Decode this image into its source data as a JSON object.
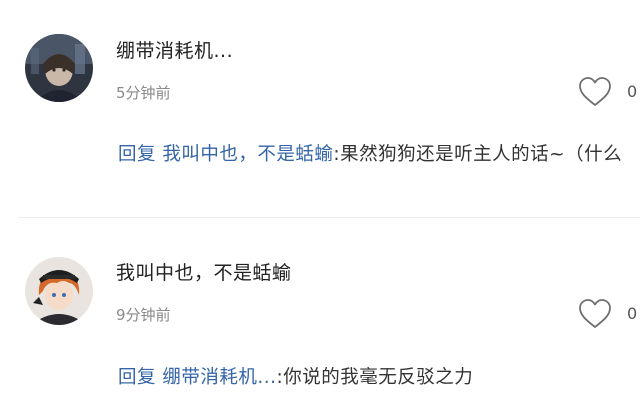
{
  "comments": [
    {
      "username": "绷带消耗机...",
      "time": "5分钟前",
      "likes": "0",
      "avatar_icon": "dark-anime-avatar-icon",
      "reply": {
        "prefix": "回复 ",
        "target": "我叫中也，不是蛞蝓",
        "text": ":果然狗狗还是听主人的话~（什么"
      }
    },
    {
      "username": "我叫中也，不是蛞蝓",
      "time": "9分钟前",
      "likes": "0",
      "avatar_icon": "orange-hair-anime-avatar-icon",
      "reply": {
        "prefix": "回复 ",
        "target": "绷带消耗机...",
        "text": ":你说的我毫无反驳之力"
      }
    }
  ],
  "icons": {
    "like": "heart-outline-icon"
  },
  "colors": {
    "link": "#3565a8",
    "text": "#222222",
    "muted": "#8a8a8a",
    "divider": "#ececec"
  }
}
